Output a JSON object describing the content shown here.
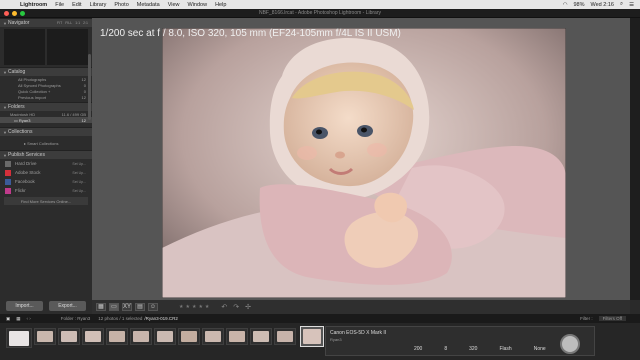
{
  "menubar": {
    "items": [
      "Lightroom",
      "File",
      "Edit",
      "Library",
      "Photo",
      "Metadata",
      "View",
      "Window",
      "Help"
    ],
    "battery": "98%",
    "clock": "Wed 2:16"
  },
  "window": {
    "title": "NBF_8166.lrcat - Adobe Photoshop Lightroom - Library"
  },
  "left_panel": {
    "navigator": "Navigator",
    "nav_modes": [
      "FIT",
      "FILL",
      "1:1",
      "2:1"
    ],
    "catalog_title": "Catalog",
    "catalog_items": [
      {
        "label": "All Photographs",
        "count": "12"
      },
      {
        "label": "All Synced Photographs",
        "count": "0"
      },
      {
        "label": "Quick Collection +",
        "count": "0"
      },
      {
        "label": "Previous Import",
        "count": "12"
      }
    ],
    "folders_title": "Folders",
    "volume": {
      "label": "Macintosh HD",
      "size": "11.6 / 499 GB"
    },
    "folder": {
      "label": "Ryan3",
      "count": "12"
    },
    "collections_title": "Collections",
    "smart_collections": "Smart Collections",
    "publish_title": "Publish Services",
    "services": [
      {
        "label": "Hard Drive",
        "state": "Set Up...",
        "color": "#6a6a6a"
      },
      {
        "label": "Adobe Stock",
        "state": "Set Up...",
        "color": "#d4303b"
      },
      {
        "label": "Facebook",
        "state": "Set Up...",
        "color": "#3b5b99"
      },
      {
        "label": "Flickr",
        "state": "Set Up...",
        "color": "#c03b8c"
      }
    ],
    "find_more": "Find More Services Online...",
    "import_label": "Import...",
    "export_label": "Export..."
  },
  "photo_info": "1/200 sec at f / 8.0, ISO 320, 105 mm (EF24-105mm f/4L IS II USM)",
  "filmstrip_bar": {
    "folder": "Folder : Ryan3",
    "count": "12 photos / 1 selected",
    "file": "/Ryan3-019.CR2",
    "filter_label": "Filter :",
    "filter_value": "Filters Off"
  },
  "metadata_panel": {
    "camera": "Canon EOS-5D X Mark II",
    "sub": "Ryan3",
    "values": [
      "200",
      "8",
      "320",
      "Flash",
      "None"
    ]
  },
  "colors": {
    "accent": "#d4303b",
    "panel": "#2c2c2c"
  }
}
